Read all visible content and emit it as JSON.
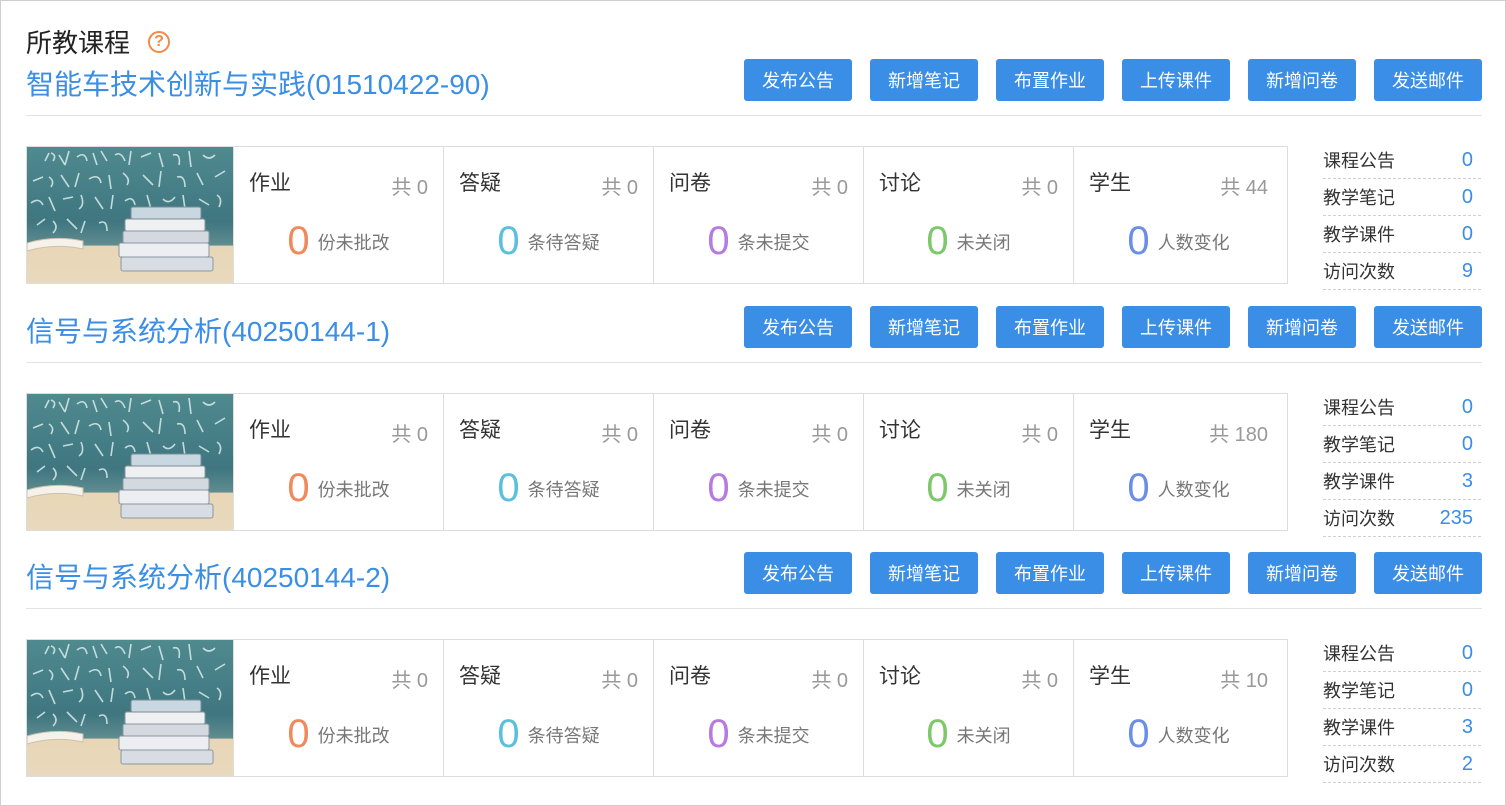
{
  "page": {
    "title": "所教课程",
    "help_icon": "question-circle-icon"
  },
  "colors": {
    "accent": "#3a8ee6",
    "homework": "#f08a5d",
    "qa": "#5bc0de",
    "survey": "#b57be0",
    "discussion": "#7ec86b",
    "students": "#6b8ee6"
  },
  "actions": [
    "发布公告",
    "新增笔记",
    "布置作业",
    "上传课件",
    "新增问卷",
    "发送邮件"
  ],
  "courses": [
    {
      "name": "智能车技术创新与实践(01510422-90)",
      "stats": [
        {
          "label": "作业",
          "total": "共 0",
          "value": "0",
          "unit": "份未批改"
        },
        {
          "label": "答疑",
          "total": "共 0",
          "value": "0",
          "unit": "条待答疑"
        },
        {
          "label": "问卷",
          "total": "共 0",
          "value": "0",
          "unit": "条未提交"
        },
        {
          "label": "讨论",
          "total": "共 0",
          "value": "0",
          "unit": "未关闭"
        },
        {
          "label": "学生",
          "total": "共 44",
          "value": "0",
          "unit": "人数变化"
        }
      ],
      "side": [
        {
          "label": "课程公告",
          "value": "0"
        },
        {
          "label": "教学笔记",
          "value": "0"
        },
        {
          "label": "教学课件",
          "value": "0"
        },
        {
          "label": "访问次数",
          "value": "9"
        }
      ]
    },
    {
      "name": "信号与系统分析(40250144-1)",
      "stats": [
        {
          "label": "作业",
          "total": "共 0",
          "value": "0",
          "unit": "份未批改"
        },
        {
          "label": "答疑",
          "total": "共 0",
          "value": "0",
          "unit": "条待答疑"
        },
        {
          "label": "问卷",
          "total": "共 0",
          "value": "0",
          "unit": "条未提交"
        },
        {
          "label": "讨论",
          "total": "共 0",
          "value": "0",
          "unit": "未关闭"
        },
        {
          "label": "学生",
          "total": "共 180",
          "value": "0",
          "unit": "人数变化"
        }
      ],
      "side": [
        {
          "label": "课程公告",
          "value": "0"
        },
        {
          "label": "教学笔记",
          "value": "0"
        },
        {
          "label": "教学课件",
          "value": "3"
        },
        {
          "label": "访问次数",
          "value": "235"
        }
      ]
    },
    {
      "name": "信号与系统分析(40250144-2)",
      "stats": [
        {
          "label": "作业",
          "total": "共 0",
          "value": "0",
          "unit": "份未批改"
        },
        {
          "label": "答疑",
          "total": "共 0",
          "value": "0",
          "unit": "条待答疑"
        },
        {
          "label": "问卷",
          "total": "共 0",
          "value": "0",
          "unit": "条未提交"
        },
        {
          "label": "讨论",
          "total": "共 0",
          "value": "0",
          "unit": "未关闭"
        },
        {
          "label": "学生",
          "total": "共 10",
          "value": "0",
          "unit": "人数变化"
        }
      ],
      "side": [
        {
          "label": "课程公告",
          "value": "0"
        },
        {
          "label": "教学笔记",
          "value": "0"
        },
        {
          "label": "教学课件",
          "value": "3"
        },
        {
          "label": "访问次数",
          "value": "2"
        }
      ]
    }
  ]
}
